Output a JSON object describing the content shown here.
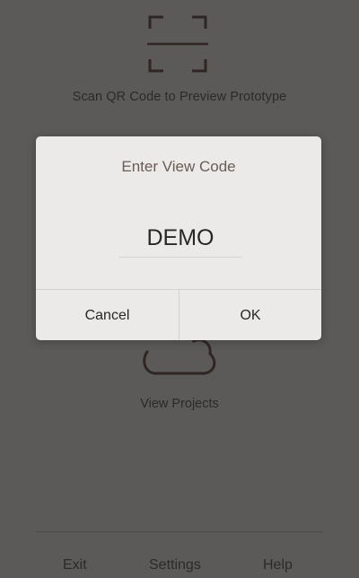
{
  "background": {
    "scan_label": "Scan QR Code to Preview Prototype",
    "projects_label": "View Projects",
    "icons": [
      "qr-scan-frame-icon",
      "cloud-icon"
    ]
  },
  "bottom_nav": {
    "exit": "Exit",
    "settings": "Settings",
    "help": "Help"
  },
  "dialog": {
    "title": "Enter View Code",
    "code_value": "DEMO",
    "cancel_label": "Cancel",
    "ok_label": "OK"
  },
  "colors": {
    "overlay": "#5b5a58",
    "dialog_bg": "#eceae8",
    "title_text": "#6a5b55",
    "icon_stroke": "#2f2624"
  }
}
